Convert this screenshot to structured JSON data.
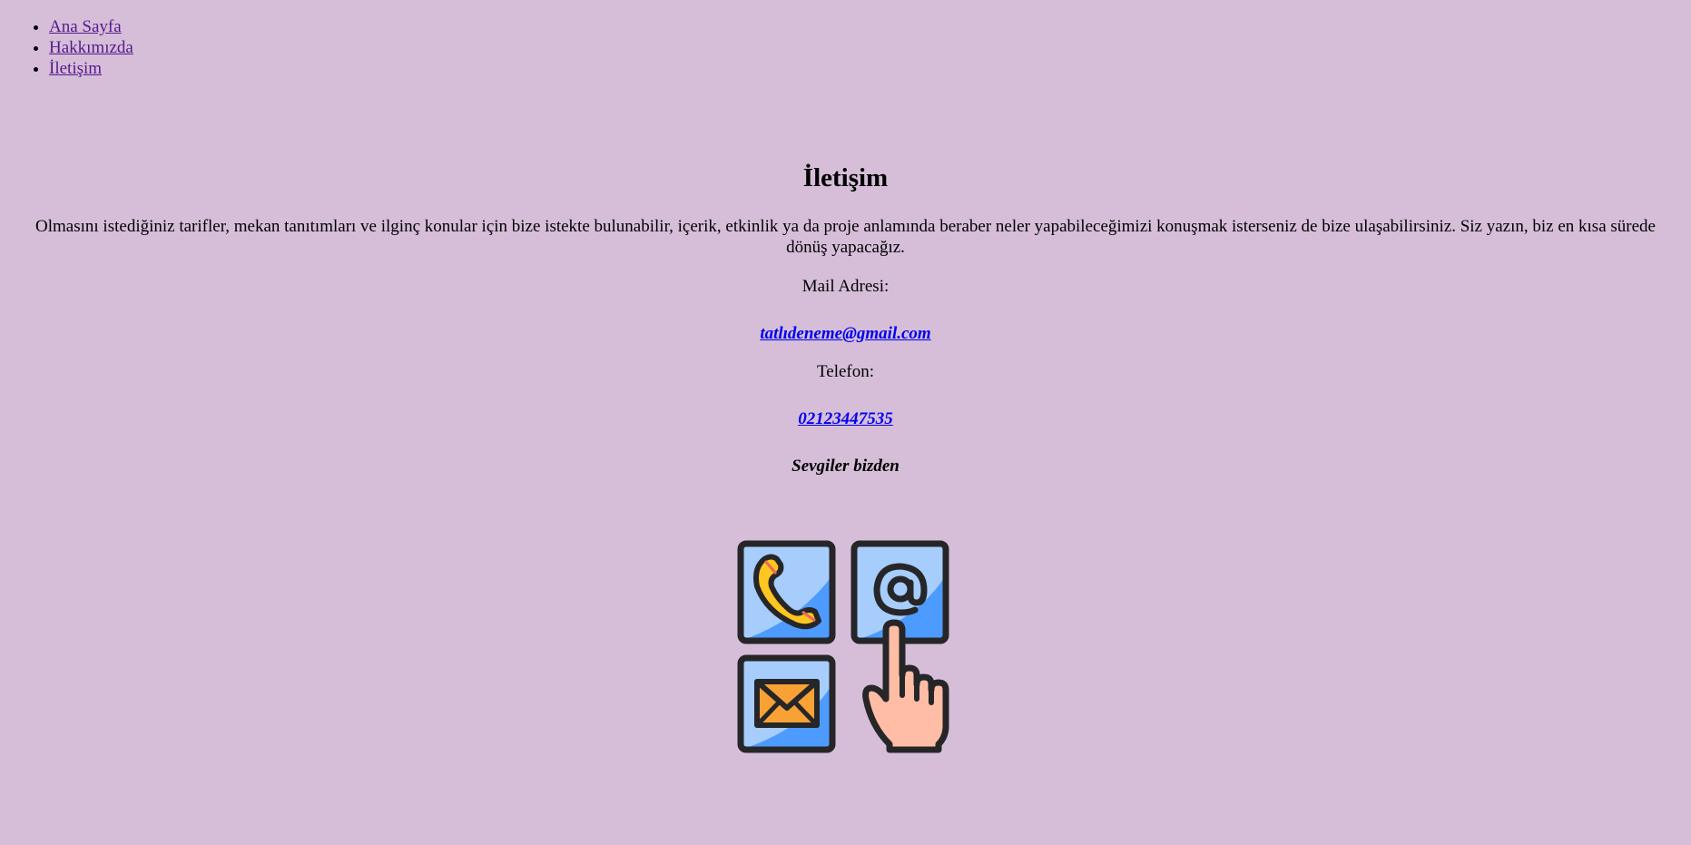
{
  "nav": {
    "items": [
      {
        "label": "Ana Sayfa"
      },
      {
        "label": "Hakkımızda"
      },
      {
        "label": "İletişim"
      }
    ]
  },
  "main": {
    "title": "İletişim",
    "intro": "Olmasını istediğiniz tarifler, mekan tanıtımları ve ilginç konular için bize istekte bulunabilir, içerik, etkinlik ya da proje anlamında beraber neler yapabileceğimizi konuşmak isterseniz de bize ulaşabilirsiniz. Siz yazın, biz en kısa sürede dönüş yapacağız.",
    "mail_label": "Mail Adresi:",
    "mail_value": "tatlıdeneme@gmail.com",
    "phone_label": "Telefon:",
    "phone_value": "02123447535",
    "signoff": "Sevgiler bizden"
  },
  "graphic": {
    "icons": [
      "phone-icon",
      "at-sign-icon",
      "envelope-icon",
      "pointing-hand-icon"
    ],
    "colors": {
      "tile_blue": "#4d9bff",
      "tile_light": "#a6cdfb",
      "outline": "#262629",
      "phone_yellow": "#ffc61f",
      "envelope_orange": "#f8a236",
      "hand_skin": "#ffbda6"
    }
  }
}
